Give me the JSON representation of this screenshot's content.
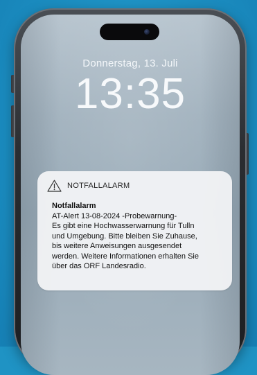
{
  "lock_screen": {
    "date": "Donnerstag, 13. Juli",
    "time": "13:35"
  },
  "notification": {
    "icon": "warning-icon",
    "app_name": "NOTFALLALARM",
    "title": "Notfallalarm",
    "lines": [
      "AT-Alert 13-08-2024 -Probewarnung-",
      "Es gibt eine Hochwasserwarnung für Tulln",
      "und Umgebung. Bitte bleiben Sie Zuhause,",
      "bis weitere Anweisungen ausgesendet",
      "werden. Weitere Informationen erhalten Sie",
      "über das ORF Landesradio."
    ]
  },
  "colors": {
    "background": "#1f93c4",
    "phone_frame": "#2a2d31",
    "notification_bg": "#f2f3f5"
  }
}
